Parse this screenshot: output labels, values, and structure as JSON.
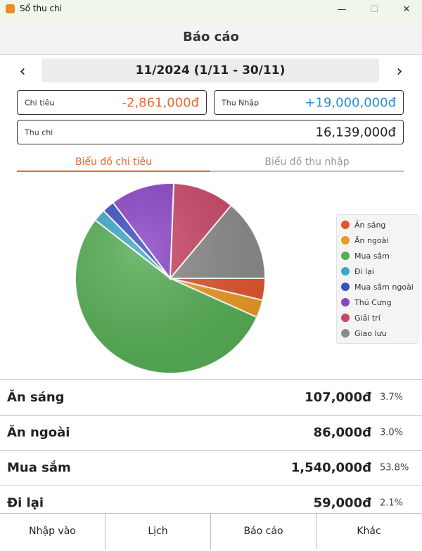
{
  "window": {
    "title": "Sổ thu chi",
    "minimize": "—",
    "maximize": "☐",
    "close": "✕"
  },
  "header": {
    "title": "Báo cáo"
  },
  "period": {
    "prev": "‹",
    "next": "›",
    "label": "11/2024 (1/11 - 30/11)"
  },
  "summary": {
    "expense_label": "Chi tiêu",
    "expense_value": "-2,861,000đ",
    "income_label": "Thu Nhập",
    "income_value": "+19,000,000đ",
    "net_label": "Thu chi",
    "net_value": "16,139,000đ"
  },
  "tabs": {
    "expense_chart": "Biểu đồ chi tiêu",
    "income_chart": "Biểu đồ thu nhập"
  },
  "colors": {
    "expense": "#e8692a",
    "income": "#2b8ed1"
  },
  "chart_data": {
    "type": "pie",
    "categories": [
      "Ăn sáng",
      "Ăn ngoài",
      "Mua sắm",
      "Đi lại",
      "Mua sắm ngoài",
      "Thú Cưng",
      "Giải trí",
      "Giao lưu"
    ],
    "values": [
      3.7,
      3.0,
      53.8,
      2.1,
      2.1,
      10.9,
      10.5,
      13.9
    ],
    "colors": [
      "#e2552e",
      "#e99a22",
      "#55ad55",
      "#3fa6c9",
      "#3c4fc1",
      "#8b44c6",
      "#c84766",
      "#8a8a8a"
    ],
    "legend": "right"
  },
  "list": [
    {
      "name": "Ăn sáng",
      "amount": "107,000đ",
      "percent": "3.7%"
    },
    {
      "name": "Ăn ngoài",
      "amount": "86,000đ",
      "percent": "3.0%"
    },
    {
      "name": "Mua sắm",
      "amount": "1,540,000đ",
      "percent": "53.8%"
    },
    {
      "name": "Đi lại",
      "amount": "59,000đ",
      "percent": "2.1%"
    }
  ],
  "nav": {
    "input": "Nhập vào",
    "calendar": "Lịch",
    "report": "Báo cáo",
    "other": "Khác"
  }
}
